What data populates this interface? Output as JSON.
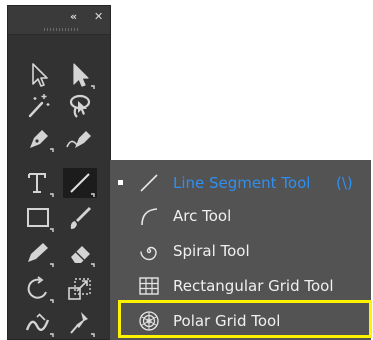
{
  "toolbar": {
    "collapse_glyph": "«",
    "close_glyph": "✕",
    "tools": [
      {
        "name": "selection-tool-icon"
      },
      {
        "name": "direct-selection-tool-icon"
      },
      {
        "name": "magic-wand-tool-icon"
      },
      {
        "name": "lasso-tool-icon"
      },
      {
        "name": "pen-tool-icon"
      },
      {
        "name": "curvature-tool-icon"
      },
      {
        "name": "type-tool-icon",
        "glyph": "T"
      },
      {
        "name": "line-segment-tool-icon"
      },
      {
        "name": "rectangle-tool-icon"
      },
      {
        "name": "paintbrush-tool-icon"
      },
      {
        "name": "shaper-tool-icon"
      },
      {
        "name": "eraser-tool-icon"
      },
      {
        "name": "rotate-tool-icon"
      },
      {
        "name": "scale-tool-icon"
      },
      {
        "name": "width-tool-icon"
      },
      {
        "name": "puppet-warp-tool-icon"
      }
    ]
  },
  "flyout": {
    "items": [
      {
        "icon": "line-segment-icon",
        "label": "Line Segment Tool",
        "shortcut": "(\\)",
        "active": true
      },
      {
        "icon": "arc-icon",
        "label": "Arc Tool",
        "shortcut": "",
        "active": false
      },
      {
        "icon": "spiral-icon",
        "label": "Spiral Tool",
        "shortcut": "",
        "active": false
      },
      {
        "icon": "rectangular-grid-icon",
        "label": "Rectangular Grid Tool",
        "shortcut": "",
        "active": false
      },
      {
        "icon": "polar-grid-icon",
        "label": "Polar Grid Tool",
        "shortcut": "",
        "active": false
      }
    ]
  },
  "colors": {
    "panel_bg": "#323232",
    "flyout_bg": "#535353",
    "active_text": "#2f8ff0",
    "highlight": "#fff200"
  }
}
